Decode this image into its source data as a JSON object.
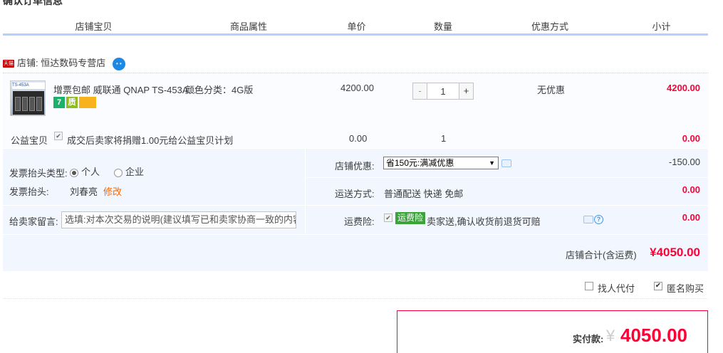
{
  "section_title": "确认订单信息",
  "columns": [
    "店铺宝贝",
    "商品属性",
    "单价",
    "数量",
    "优惠方式",
    "小计"
  ],
  "shop": {
    "tmall_badge": "天猫",
    "label": "店铺:",
    "name": "恒达数码专营店",
    "chat_icon": "wangwang-icon"
  },
  "item": {
    "thumb_caption": "TS-453A",
    "title": "增票包邮 威联通 QNAP TS-453A...",
    "property": "颜色分类：4G版",
    "badges": [
      "7",
      "质",
      "卡"
    ],
    "unit_price": "4200.00",
    "quantity": "1",
    "minus_label": "-",
    "plus_label": "+",
    "discount": "无优惠",
    "subtotal": "4200.00"
  },
  "charity": {
    "label": "公益宝贝",
    "text": "成交后卖家将捐赠1.00元给公益宝贝计划",
    "price": "0.00",
    "qty": "1",
    "subtotal": "0.00",
    "checked": true
  },
  "invoice": {
    "type_label": "发票抬头类型:",
    "option_personal": "个人",
    "option_company": "企业",
    "selected": "个人",
    "header_label": "发票抬头:",
    "header_value": "刘春亮",
    "edit_link": "修改"
  },
  "message": {
    "label": "给卖家留言:",
    "placeholder": "选填:对本次交易的说明(建议填写已和卖家协商一致的内容)"
  },
  "shop_discount": {
    "label": "店铺优惠:",
    "selected": "省150元:满减优惠",
    "value": "-150.00"
  },
  "shipping": {
    "label": "运送方式:",
    "text": "普通配送 快递 免邮",
    "value": "0.00"
  },
  "insurance": {
    "label": "运费险:",
    "tag": "运费险",
    "text": "卖家送,确认收货前退货可赔",
    "value": "0.00",
    "help_icon": "?"
  },
  "shop_total": {
    "label": "店铺合计(含运费)",
    "value": "¥4050.00"
  },
  "options": {
    "proxy_pay": "找人代付",
    "anonymous": "匿名购买",
    "proxy_checked": false,
    "anonymous_checked": true
  },
  "payment": {
    "label": "实付款:",
    "currency": "¥",
    "value": "4050.00"
  },
  "colors": {
    "accent_red": "#ff0036",
    "header_line": "#b2d1ff",
    "option_bg": "#f2f7ff"
  }
}
